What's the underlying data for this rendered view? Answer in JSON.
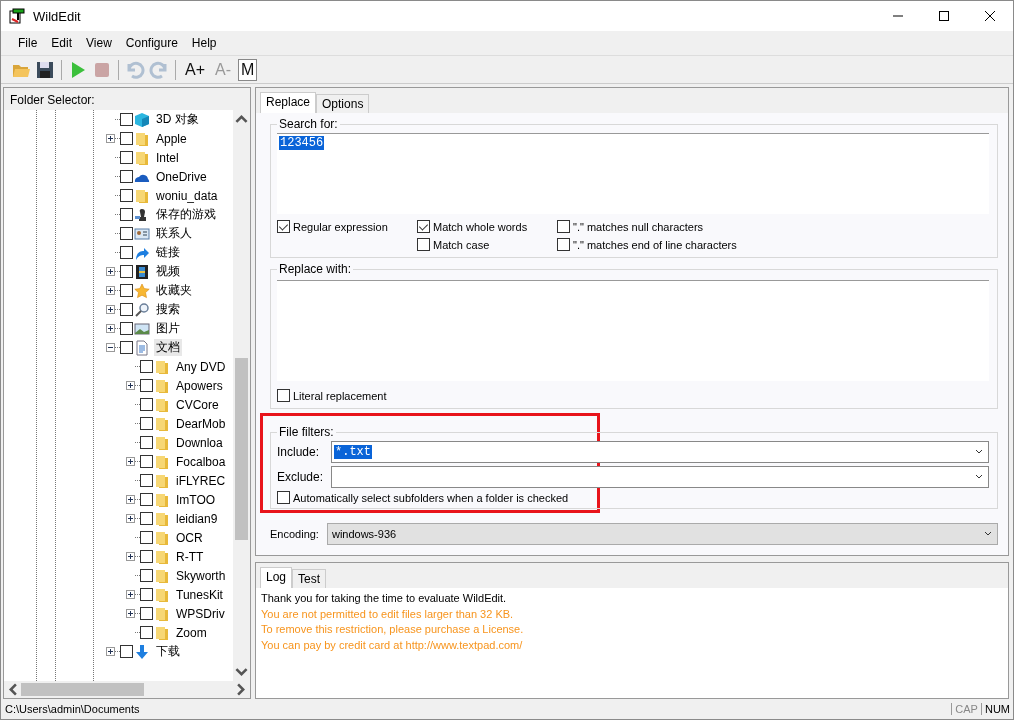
{
  "window": {
    "title": "WildEdit"
  },
  "menu": [
    "File",
    "Edit",
    "View",
    "Configure",
    "Help"
  ],
  "toolbar": [
    {
      "kind": "open",
      "disabled": false
    },
    {
      "kind": "save",
      "disabled": false
    },
    {
      "kind": "separator"
    },
    {
      "kind": "run",
      "disabled": false
    },
    {
      "kind": "stop",
      "disabled": true
    },
    {
      "kind": "separator"
    },
    {
      "kind": "undo",
      "disabled": true
    },
    {
      "kind": "redo",
      "disabled": true
    },
    {
      "kind": "separator"
    },
    {
      "kind": "text",
      "label": "A+",
      "disabled": false,
      "pressed": false
    },
    {
      "kind": "text",
      "label": "A-",
      "disabled": true,
      "pressed": false
    },
    {
      "kind": "text",
      "label": "M",
      "disabled": false,
      "pressed": true
    }
  ],
  "folder_selector": {
    "label": "Folder Selector:",
    "tree": [
      {
        "label": "3D 对象",
        "kind": "cube",
        "checked": false,
        "selected": false
      },
      {
        "label": "Apple",
        "kind": "folder",
        "expanded": false,
        "checked": false,
        "selected": false
      },
      {
        "label": "Intel",
        "kind": "folder",
        "checked": false,
        "selected": false
      },
      {
        "label": "OneDrive",
        "kind": "cloud",
        "checked": false,
        "selected": false
      },
      {
        "label": "woniu_data",
        "kind": "folder",
        "checked": false,
        "selected": false
      },
      {
        "label": "保存的游戏",
        "kind": "chess",
        "checked": false,
        "selected": false
      },
      {
        "label": "联系人",
        "kind": "contact",
        "checked": false,
        "selected": false
      },
      {
        "label": "链接",
        "kind": "shortcut",
        "checked": false,
        "selected": false
      },
      {
        "label": "视频",
        "kind": "film",
        "expanded": false,
        "checked": false,
        "selected": false
      },
      {
        "label": "收藏夹",
        "kind": "star",
        "expanded": false,
        "checked": false,
        "selected": false
      },
      {
        "label": "搜索",
        "kind": "search",
        "expanded": false,
        "checked": false,
        "selected": false
      },
      {
        "label": "图片",
        "kind": "image",
        "expanded": false,
        "checked": false,
        "selected": false
      },
      {
        "label": "文档",
        "kind": "document",
        "expanded": true,
        "checked": false,
        "selected": true,
        "children": [
          {
            "label": "Any DVD",
            "kind": "folder",
            "checked": false,
            "selected": false
          },
          {
            "label": "Apowers",
            "kind": "folder",
            "expanded": false,
            "checked": false,
            "selected": false
          },
          {
            "label": "CVCore",
            "kind": "folder",
            "checked": false,
            "selected": false
          },
          {
            "label": "DearMob",
            "kind": "folder",
            "checked": false,
            "selected": false
          },
          {
            "label": "Downloa",
            "kind": "folder",
            "checked": false,
            "selected": false
          },
          {
            "label": "Focalboa",
            "kind": "folder",
            "expanded": false,
            "checked": false,
            "selected": false
          },
          {
            "label": "iFLYREC",
            "kind": "folder",
            "checked": false,
            "selected": false
          },
          {
            "label": "ImTOO",
            "kind": "folder",
            "expanded": false,
            "checked": false,
            "selected": false
          },
          {
            "label": "leidian9",
            "kind": "folder",
            "expanded": false,
            "checked": false,
            "selected": false
          },
          {
            "label": "OCR",
            "kind": "folder",
            "checked": false,
            "selected": false
          },
          {
            "label": "R-TT",
            "kind": "folder",
            "expanded": false,
            "checked": false,
            "selected": false
          },
          {
            "label": "Skyworth",
            "kind": "folder",
            "checked": false,
            "selected": false
          },
          {
            "label": "TunesKit",
            "kind": "folder",
            "expanded": false,
            "checked": false,
            "selected": false
          },
          {
            "label": "WPSDriv",
            "kind": "folder",
            "expanded": false,
            "checked": false,
            "selected": false
          },
          {
            "label": "Zoom",
            "kind": "folder",
            "checked": false,
            "selected": false
          }
        ]
      },
      {
        "label": "下载",
        "kind": "download",
        "expanded": false,
        "checked": false,
        "selected": false
      }
    ]
  },
  "tabs": [
    {
      "label": "Replace",
      "selected": true
    },
    {
      "label": "Options",
      "selected": false
    }
  ],
  "search": {
    "label": "Search for:",
    "value": "123456",
    "options": [
      {
        "label": "Regular expression",
        "checked": true
      },
      {
        "label": "Match whole words",
        "checked": true
      },
      {
        "label": "\".\" matches null characters",
        "checked": false
      },
      {
        "label": "Match case",
        "checked": false
      },
      {
        "label": "\".\" matches end of line characters",
        "checked": false
      }
    ]
  },
  "replace": {
    "label": "Replace with:",
    "option": {
      "label": "Literal replacement",
      "checked": false
    }
  },
  "file_filters": {
    "label": "File filters:",
    "include_label": "Include:",
    "include": "*.txt",
    "exclude_label": "Exclude:",
    "auto_select": {
      "label": "Automatically select subfolders when a folder is checked",
      "checked": false
    }
  },
  "encoding": {
    "label": "Encoding:",
    "value": "windows-936"
  },
  "log_tabs": [
    {
      "label": "Log",
      "selected": true
    },
    {
      "label": "Test",
      "selected": false
    }
  ],
  "log": [
    {
      "kind": "info",
      "text": "Thank you for taking the time to evaluate WildEdit."
    },
    {
      "kind": "warning",
      "text": "You are not permitted to edit files larger than 32 KB."
    },
    {
      "kind": "warning",
      "text": "To remove this restriction, please purchase a License."
    },
    {
      "kind": "warning",
      "text": "You can pay by credit card at http://www.textpad.com/"
    }
  ],
  "status_bar": {
    "path": "C:\\Users\\admin\\Documents",
    "indicators": [
      {
        "label": "CAP",
        "on": false
      },
      {
        "label": "NUM",
        "on": true
      }
    ]
  }
}
